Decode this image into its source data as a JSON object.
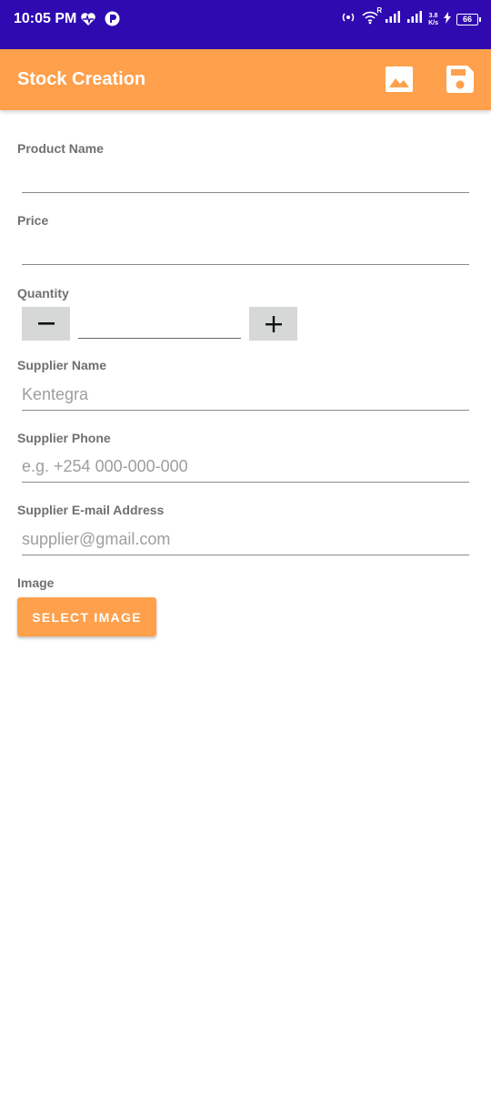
{
  "status_bar": {
    "time": "10:05 PM",
    "network_speed_value": "3.8",
    "network_speed_unit": "K/s",
    "battery": "66",
    "roaming": "R",
    "icons": [
      "heart-rate-icon",
      "app-notification-icon",
      "hotspot-icon",
      "wifi-icon",
      "signal-icon",
      "signal-icon",
      "charging-icon",
      "battery-icon"
    ]
  },
  "app_bar": {
    "title": "Stock Creation",
    "actions": [
      "image-icon",
      "save-icon"
    ],
    "color": "#ffa04c"
  },
  "form": {
    "product_name": {
      "label": "Product Name",
      "value": "",
      "placeholder": ""
    },
    "price": {
      "label": "Price",
      "value": "",
      "placeholder": ""
    },
    "quantity": {
      "label": "Quantity",
      "value": ""
    },
    "supplier_name": {
      "label": "Supplier Name",
      "placeholder": "Kentegra"
    },
    "supplier_phone": {
      "label": "Supplier Phone",
      "placeholder": "e.g. +254 000-000-000"
    },
    "supplier_email": {
      "label": "Supplier E-mail Address",
      "placeholder": "supplier@gmail.com"
    },
    "image": {
      "label": "Image",
      "button_label": "SELECT IMAGE"
    }
  },
  "colors": {
    "status_bar": "#2e0ab0",
    "accent": "#ffa04c",
    "stepper_button": "#d6d7d7"
  }
}
